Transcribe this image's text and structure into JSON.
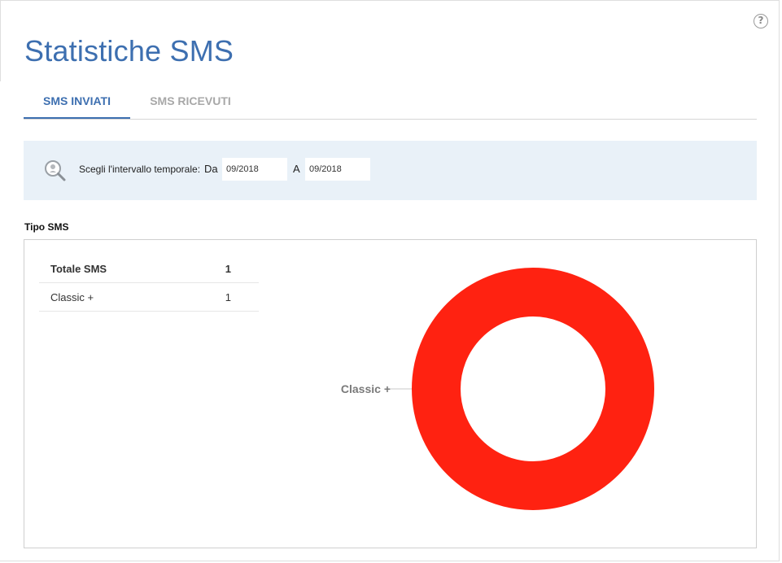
{
  "page": {
    "title": "Statistiche SMS"
  },
  "tabs": [
    {
      "label": "SMS INVIATI",
      "active": true
    },
    {
      "label": "SMS RICEVUTI",
      "active": false
    }
  ],
  "filter": {
    "label": "Scegli l'intervallo temporale:",
    "from_label": "Da",
    "from_value": "09/2018",
    "to_label": "A",
    "to_value": "09/2018"
  },
  "section": {
    "title": "Tipo SMS"
  },
  "summary": {
    "rows": [
      {
        "label": "Totale SMS",
        "value": "1"
      },
      {
        "label": "Classic +",
        "value": "1"
      }
    ]
  },
  "icons": {
    "help": "help-icon",
    "search": "search-icon"
  },
  "colors": {
    "accent": "#3d6fb0",
    "slice": "#ff2211",
    "filter_bg": "#e9f1f8"
  },
  "chart_data": {
    "type": "pie",
    "donut": true,
    "categories": [
      "Classic +"
    ],
    "values": [
      1
    ],
    "colors": [
      "#ff2211"
    ],
    "title": ""
  }
}
